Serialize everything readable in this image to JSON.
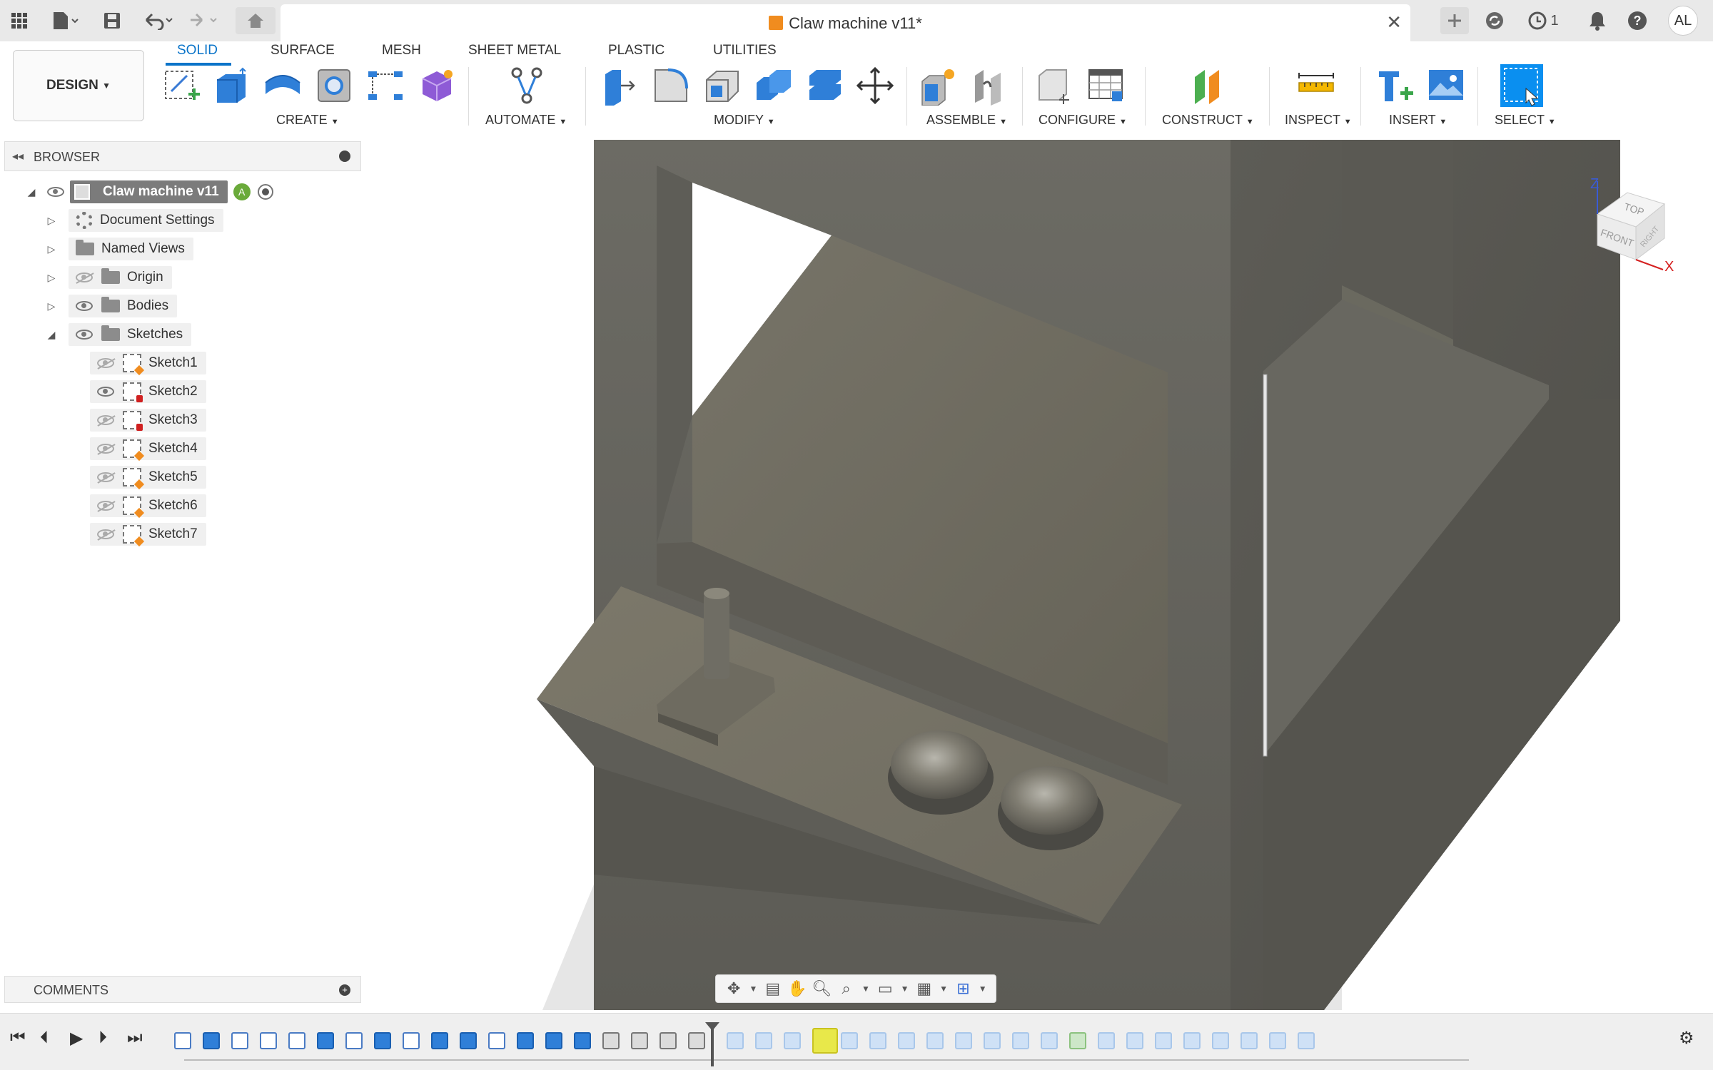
{
  "titlebar": {
    "document_title": "Claw machine v11*",
    "notifications_count": "1",
    "user_initials": "AL"
  },
  "toolbar": {
    "workspace_button": "DESIGN",
    "tabs": [
      "SOLID",
      "SURFACE",
      "MESH",
      "SHEET METAL",
      "PLASTIC",
      "UTILITIES"
    ],
    "active_tab": "SOLID",
    "groups": {
      "create": "CREATE",
      "automate": "AUTOMATE",
      "modify": "MODIFY",
      "assemble": "ASSEMBLE",
      "configure": "CONFIGURE",
      "construct": "CONSTRUCT",
      "inspect": "INSPECT",
      "insert": "INSERT",
      "select": "SELECT"
    }
  },
  "browser": {
    "header": "BROWSER",
    "root": "Claw machine v11",
    "items": [
      {
        "label": "Document Settings",
        "icon": "gear-icon"
      },
      {
        "label": "Named Views",
        "icon": "folder-icon"
      },
      {
        "label": "Origin",
        "icon": "folder-icon",
        "visible": false
      },
      {
        "label": "Bodies",
        "icon": "folder-icon",
        "visible": true
      },
      {
        "label": "Sketches",
        "icon": "folder-icon",
        "visible": true,
        "expanded": true
      }
    ],
    "sketches": [
      {
        "label": "Sketch1",
        "visible": false
      },
      {
        "label": "Sketch2",
        "visible": true
      },
      {
        "label": "Sketch3",
        "visible": false
      },
      {
        "label": "Sketch4",
        "visible": false
      },
      {
        "label": "Sketch5",
        "visible": false
      },
      {
        "label": "Sketch6",
        "visible": false
      },
      {
        "label": "Sketch7",
        "visible": false
      }
    ]
  },
  "comments": {
    "header": "COMMENTS"
  },
  "viewcube": {
    "faces": [
      "TOP",
      "FRONT",
      "RIGHT"
    ],
    "axes": [
      "Z",
      "X"
    ]
  },
  "colors": {
    "accent": "#0a74c9",
    "body": "#6b6a62",
    "body_dark": "#55544e",
    "viewport_bg": "#ffffff"
  }
}
